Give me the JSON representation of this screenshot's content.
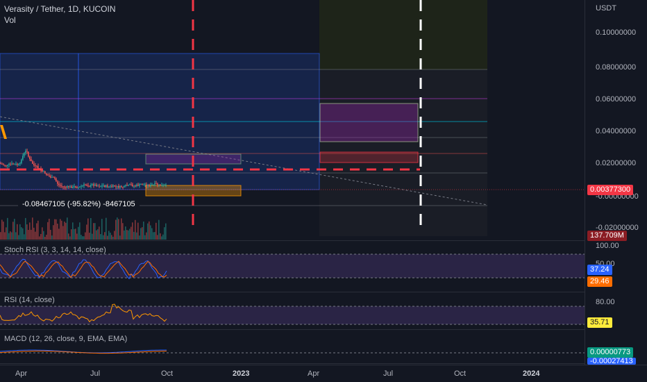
{
  "chart_header": {
    "title": "Verasity / Tether, 1D, KUCOIN",
    "sub": "Vol"
  },
  "price_axis": {
    "currency": "USDT",
    "ticks": [
      "0.10000000",
      "0.08000000",
      "0.06000000",
      "0.04000000",
      "0.02000000",
      "-0.00000000",
      "-0.02000000"
    ],
    "last_price": "0.00377300",
    "volume": "137.709M"
  },
  "measure_label": "-0.08467105 (-95.82%) -8467105",
  "stoch_rsi": {
    "label": "Stoch RSI (3, 3, 14, 14, close)",
    "top_tick": "100.00",
    "mid_tick": "50.00",
    "k": "37.24",
    "d": "29.46"
  },
  "rsi": {
    "label": "RSI (14, close)",
    "top_tick": "80.00",
    "value": "35.71"
  },
  "macd": {
    "label": "MACD (12, 26, close, 9, EMA, EMA)",
    "macd": "0.00000773",
    "signal": "-0.00027413"
  },
  "time_axis": [
    {
      "label": "Apr",
      "bold": false
    },
    {
      "label": "Jul",
      "bold": false
    },
    {
      "label": "Oct",
      "bold": false
    },
    {
      "label": "2023",
      "bold": true
    },
    {
      "label": "Apr",
      "bold": false
    },
    {
      "label": "Jul",
      "bold": false
    },
    {
      "label": "Oct",
      "bold": false
    },
    {
      "label": "2024",
      "bold": true
    }
  ],
  "colors": {
    "background": "#131722",
    "red_dash": "#f23645",
    "white_dash": "#ffffff",
    "candle_up": "#26a69a",
    "candle_down": "#ef5350",
    "stoch_fill": "#7e57c2",
    "rsi_line": "#ff9800",
    "price_badge": "#f23645",
    "volume_badge": "#8b1d24",
    "stoch_k_badge": "#2962ff",
    "stoch_d_badge": "#ff6d00",
    "rsi_badge": "#ffeb3b",
    "macd_badge": "#089981",
    "signal_badge": "#2962ff"
  }
}
